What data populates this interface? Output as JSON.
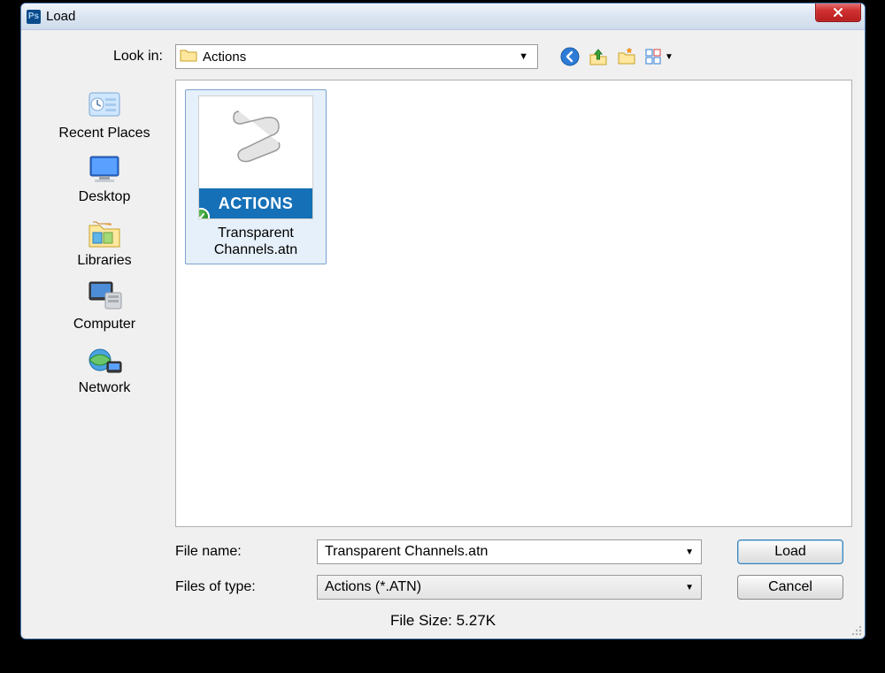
{
  "window": {
    "title": "Load"
  },
  "lookin": {
    "label": "Look in:",
    "value": "Actions"
  },
  "toolbar": {
    "back_icon": "back-icon",
    "up_icon": "up-one-level-icon",
    "newfolder_icon": "new-folder-icon",
    "view_icon": "view-menu-icon"
  },
  "places": [
    {
      "label": "Recent Places"
    },
    {
      "label": "Desktop"
    },
    {
      "label": "Libraries"
    },
    {
      "label": "Computer"
    },
    {
      "label": "Network"
    }
  ],
  "file": {
    "thumb_label": "ACTIONS",
    "caption_line1": "Transparent",
    "caption_line2": "Channels.atn"
  },
  "form": {
    "filename_label": "File name:",
    "filename_value": "Transparent Channels.atn",
    "filetype_label": "Files of type:",
    "filetype_value": "Actions (*.ATN)"
  },
  "buttons": {
    "load": "Load",
    "cancel": "Cancel"
  },
  "footer": {
    "size": "File Size: 5.27K"
  }
}
